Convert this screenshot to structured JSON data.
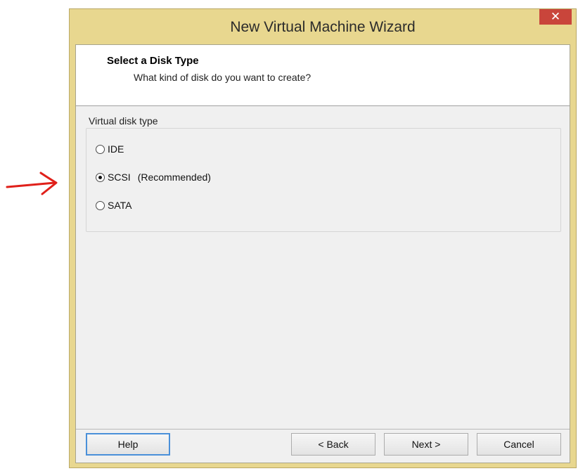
{
  "window": {
    "title": "New Virtual Machine Wizard",
    "close_glyph": "✕"
  },
  "header": {
    "title": "Select a Disk Type",
    "subtitle": "What kind of disk do you want to create?"
  },
  "disk_type_group": {
    "label": "Virtual disk type",
    "options": [
      {
        "label": "IDE",
        "extra": "",
        "selected": false
      },
      {
        "label": "SCSI",
        "extra": "(Recommended)",
        "selected": true
      },
      {
        "label": "SATA",
        "extra": "",
        "selected": false
      }
    ]
  },
  "buttons": {
    "help": "Help",
    "back": "< Back",
    "next": "Next >",
    "cancel": "Cancel"
  },
  "colors": {
    "title_bar": "#e8d78f",
    "close_button": "#c9453b",
    "annotation_arrow": "#e0201a",
    "default_button_border": "#4a90d9"
  },
  "annotation": {
    "icon": "red-arrow-right-icon"
  }
}
